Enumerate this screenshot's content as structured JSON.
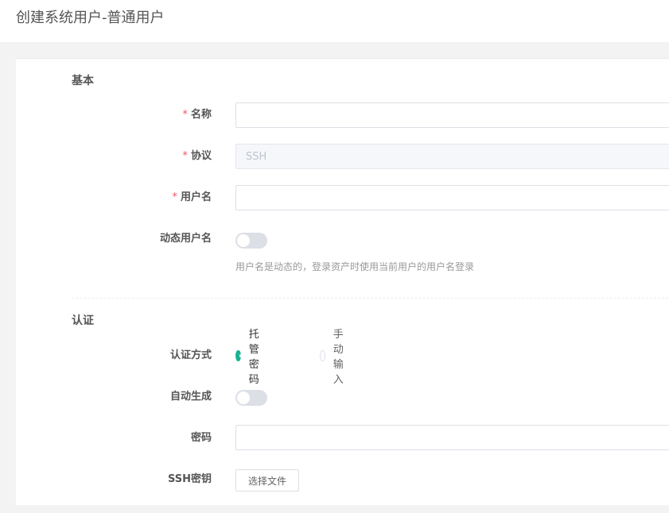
{
  "header": {
    "title": "创建系统用户-普通用户"
  },
  "basic_section": {
    "title": "基本",
    "name": {
      "label": "名称",
      "required": "*",
      "value": ""
    },
    "protocol": {
      "label": "协议",
      "required": "*",
      "value": "SSH"
    },
    "username": {
      "label": "用户名",
      "required": "*",
      "value": ""
    },
    "dynamic_username": {
      "label": "动态用户名",
      "enabled": false,
      "help": "用户名是动态的，登录资产时使用当前用户的用户名登录"
    }
  },
  "auth_section": {
    "title": "认证",
    "auth_method": {
      "label": "认证方式",
      "options": [
        "托管密码",
        "手动输入"
      ],
      "selected": "托管密码"
    },
    "auto_generate": {
      "label": "自动生成",
      "enabled": false
    },
    "password": {
      "label": "密码",
      "value": ""
    },
    "ssh_key": {
      "label": "SSH密钥",
      "button_label": "选择文件"
    }
  },
  "colors": {
    "accent": "#1ab394",
    "required": "#ed5565",
    "toggle_off": "#dcdfe6"
  }
}
